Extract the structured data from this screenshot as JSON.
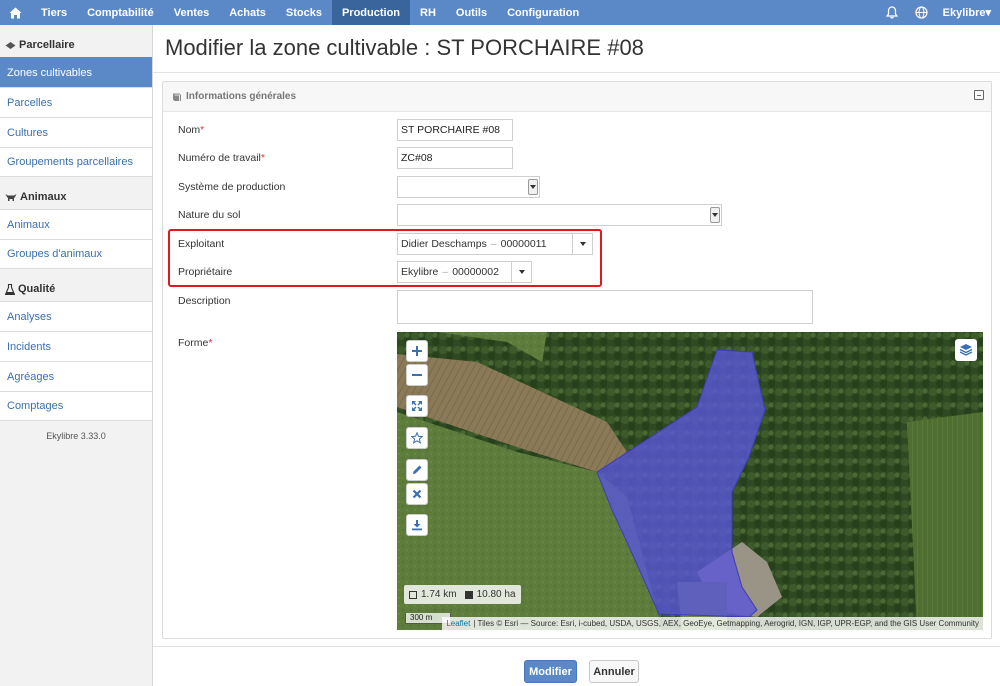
{
  "nav": {
    "items": [
      {
        "label": "Tiers"
      },
      {
        "label": "Comptabilité"
      },
      {
        "label": "Ventes"
      },
      {
        "label": "Achats"
      },
      {
        "label": "Stocks"
      },
      {
        "label": "Production"
      },
      {
        "label": "RH"
      },
      {
        "label": "Outils"
      },
      {
        "label": "Configuration"
      }
    ],
    "active": "Production",
    "user": "Ekylibre▾"
  },
  "sidebar": {
    "sections": [
      {
        "title": "Parcellaire",
        "icon": "map-icon",
        "items": [
          {
            "label": "Zones cultivables",
            "active": true
          },
          {
            "label": "Parcelles"
          },
          {
            "label": "Cultures"
          },
          {
            "label": "Groupements parcellaires"
          }
        ]
      },
      {
        "title": "Animaux",
        "icon": "cow-icon",
        "items": [
          {
            "label": "Animaux"
          },
          {
            "label": "Groupes d'animaux"
          }
        ]
      },
      {
        "title": "Qualité",
        "icon": "flask-icon",
        "items": [
          {
            "label": "Analyses"
          },
          {
            "label": "Incidents"
          },
          {
            "label": "Agréages"
          },
          {
            "label": "Comptages"
          }
        ]
      }
    ],
    "version": "Ekylibre 3.33.0"
  },
  "page": {
    "title": "Modifier la zone cultivable : ST PORCHAIRE #08"
  },
  "panel": {
    "title": "Informations générales",
    "fields": {
      "nom": {
        "label": "Nom",
        "required": "*",
        "value": "ST PORCHAIRE #08"
      },
      "numero": {
        "label": "Numéro de travail",
        "required": "*",
        "value": "ZC#08"
      },
      "systeme": {
        "label": "Système de production",
        "value": ""
      },
      "nature": {
        "label": "Nature du sol",
        "value": ""
      },
      "exploitant": {
        "label": "Exploitant",
        "name": "Didier Deschamps",
        "sep": "–",
        "number": "00000011"
      },
      "proprietaire": {
        "label": "Propriétaire",
        "name": "Ekylibre",
        "sep": "–",
        "number": "00000002"
      },
      "description": {
        "label": "Description",
        "value": ""
      },
      "forme": {
        "label": "Forme",
        "required": "*"
      }
    }
  },
  "map": {
    "length": "1.74 km",
    "area": "10.80 ha",
    "scale": "300 m",
    "attribution_link": "Leaflet",
    "attribution": "| Tiles © Esri — Source: Esri, i-cubed, USDA, USGS, AEX, GeoEye, Getmapping, Aerogrid, IGN, IGP, UPR-EGP, and the GIS User Community",
    "controls": [
      "zoom-in-icon",
      "zoom-out-icon",
      "fullscreen-icon",
      "star-icon",
      "pencil-icon",
      "delete-icon",
      "download-icon",
      "layers-icon"
    ],
    "polygon_color": "#5a57d6"
  },
  "footer": {
    "save": "Modifier",
    "cancel": "Annuler"
  },
  "colors": {
    "nav": "#5b89c8",
    "nav_active": "#39659c",
    "highlight": "#e0191f"
  }
}
